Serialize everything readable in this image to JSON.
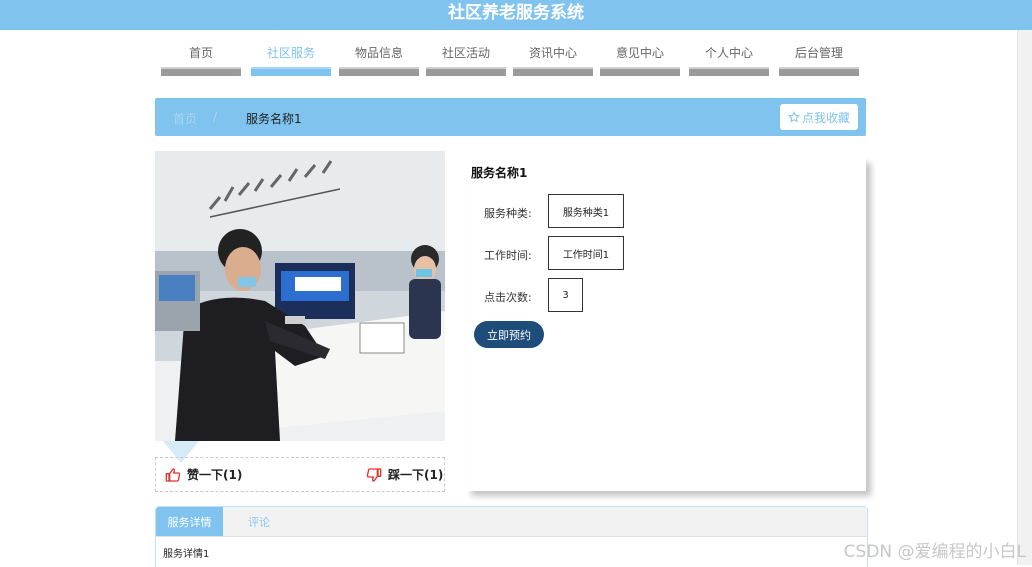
{
  "app": {
    "title": "社区养老服务系统"
  },
  "nav": {
    "items": [
      {
        "label": "首页"
      },
      {
        "label": "社区服务"
      },
      {
        "label": "物品信息"
      },
      {
        "label": "社区活动"
      },
      {
        "label": "资讯中心"
      },
      {
        "label": "意见中心"
      },
      {
        "label": "个人中心"
      },
      {
        "label": "后台管理"
      }
    ],
    "active": "社区服务"
  },
  "breadcrumb": {
    "home": "首页",
    "separator": "/",
    "current": "服务名称1"
  },
  "favorite": {
    "icon": "star-outline-icon",
    "label": "点我收藏"
  },
  "votes": {
    "up": {
      "icon": "thumbs-up-icon",
      "label": "赞一下(1)"
    },
    "down": {
      "icon": "thumbs-down-icon",
      "label": "踩一下(1)"
    }
  },
  "detail": {
    "title": "服务名称1",
    "fields": [
      {
        "label": "服务种类:",
        "value": "服务种类1"
      },
      {
        "label": "工作时间:",
        "value": "工作时间1"
      },
      {
        "label": "点击次数:",
        "value": "3"
      }
    ],
    "book_label": "立即预约"
  },
  "tabs": {
    "items": [
      {
        "label": "服务详情"
      },
      {
        "label": "评论"
      }
    ],
    "active_content": "服务详情1"
  },
  "watermark": "CSDN @爱编程的小白L",
  "colors": {
    "primary": "#7fc3ee",
    "button_dark": "#1e4d7a",
    "icon_red": "#e0322b"
  }
}
